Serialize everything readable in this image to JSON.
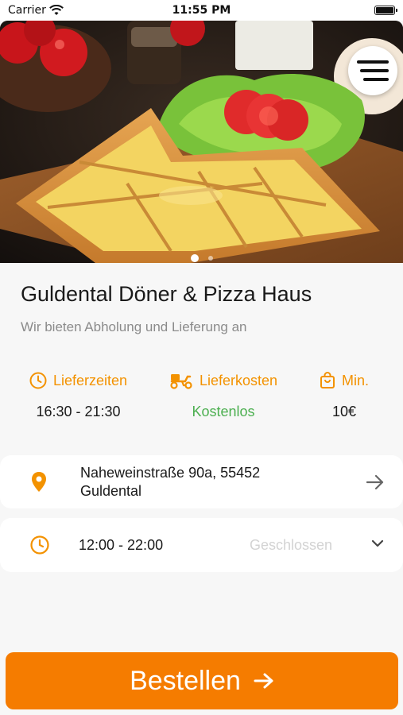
{
  "status_bar": {
    "carrier": "Carrier",
    "time": "11:55 PM"
  },
  "hero": {
    "image_description_icon": "pizza-photo",
    "carousel_pages": 2,
    "active_page": 1
  },
  "restaurant": {
    "name": "Guldental Döner & Pizza Haus",
    "tagline": "Wir bieten Abholung und Lieferung an"
  },
  "info": {
    "delivery_times_label": "Lieferzeiten",
    "delivery_times_value": "16:30 - 21:30",
    "delivery_cost_label": "Lieferkosten",
    "delivery_cost_value": "Kostenlos",
    "minimum_label": "Min.",
    "minimum_value": "10€"
  },
  "address": {
    "line1": "Naheweinstraße 90a, 55452",
    "line2": "Guldental"
  },
  "hours": {
    "range": "12:00 - 22:00",
    "status": "Geschlossen"
  },
  "order_button": {
    "label": "Bestellen"
  },
  "colors": {
    "accent": "#f39200",
    "button": "#f57c00",
    "free": "#4caf50"
  }
}
